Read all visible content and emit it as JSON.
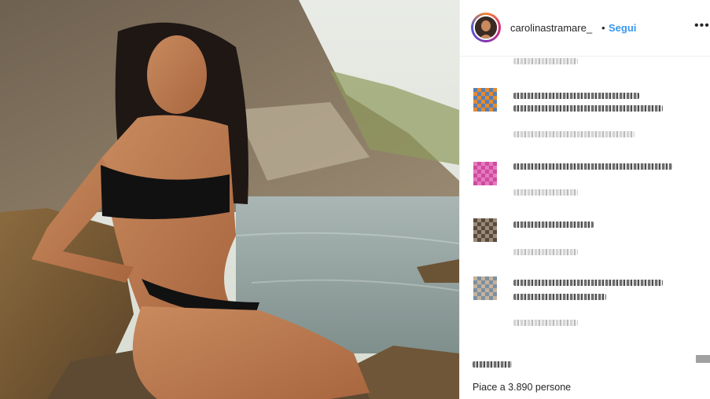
{
  "post": {
    "username": "carolinastramare_",
    "separator": "•",
    "follow_label": "Segui",
    "more_icon": "more-options-icon",
    "likes_text": "Piace a 3.890 persone"
  },
  "comments": [
    {
      "avatar_color": "#e68a2e",
      "blurred": true
    },
    {
      "avatar_color": "#d24aa0",
      "blurred": true
    },
    {
      "avatar_color": "#9a8a78",
      "blurred": true
    },
    {
      "avatar_color": "#7c8fa3",
      "blurred": true
    }
  ],
  "colors": {
    "link": "#3897f0",
    "text": "#262626",
    "border": "#efefef"
  }
}
